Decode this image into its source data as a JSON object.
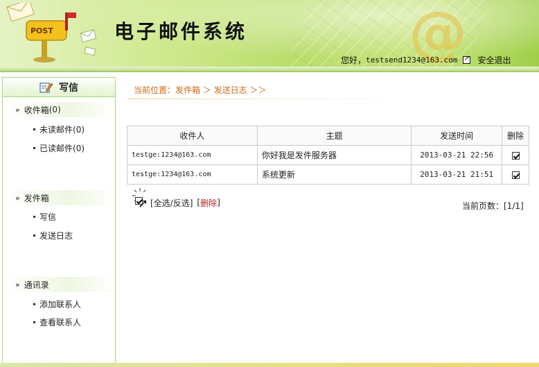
{
  "header": {
    "title": "电子邮件系统",
    "greeting": "您好，",
    "email": "testsend1234@163.com",
    "logout_label": "安全退出",
    "mailbox_label": "POST"
  },
  "sidebar": {
    "compose_label": "写信",
    "inbox": {
      "label": "收件箱",
      "count": "(0)"
    },
    "inbox_items": [
      {
        "label": "未读邮件",
        "count": "(0)"
      },
      {
        "label": "已读邮件",
        "count": "(0)"
      }
    ],
    "outbox_label": "发件箱",
    "outbox_items": [
      {
        "label": "写信"
      },
      {
        "label": "发送日志"
      }
    ],
    "contacts_label": "通讯录",
    "contacts_items": [
      {
        "label": "添加联系人"
      },
      {
        "label": "查看联系人"
      }
    ]
  },
  "breadcrumb": {
    "text": "当前位置：发件箱 ＞ 发送日志 ＞＞"
  },
  "table": {
    "headers": [
      "收件人",
      "主题",
      "发送时间",
      "删除"
    ],
    "rows": [
      {
        "recipient": "testge:1234@163.com",
        "subject": "你好我是发件服务器",
        "time": "2013-03-21 22:56",
        "checked": true
      },
      {
        "recipient": "testge:1234@163.com",
        "subject": "系统更新",
        "time": "2013-03-21 21:51",
        "checked": true
      }
    ]
  },
  "actions": {
    "select_all": "[全选/反选]",
    "delete_open": "[",
    "delete_label": "删除",
    "delete_close": "]"
  },
  "pagination": {
    "text": "当前页数：[1/1]"
  },
  "colors": {
    "accent": "#d06a1a",
    "delete": "#b3261e",
    "sidebar_border": "#a8d37d"
  }
}
